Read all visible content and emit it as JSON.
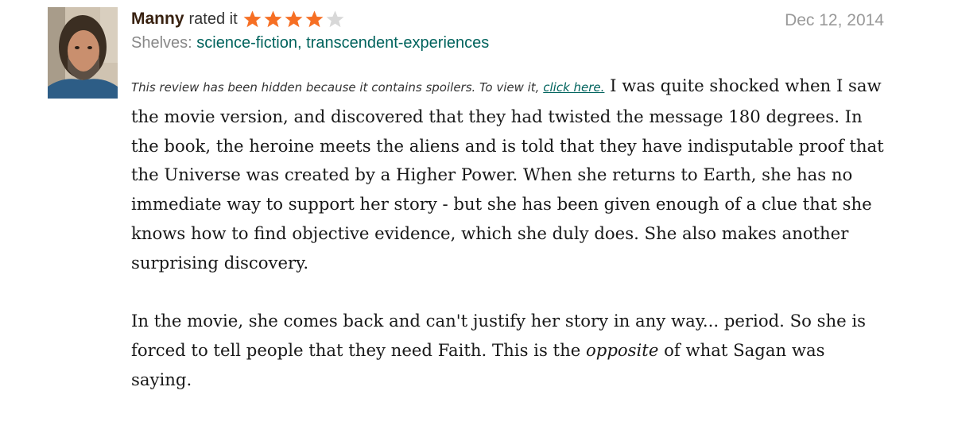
{
  "reviewer": {
    "name": "Manny",
    "rated_text": "rated it",
    "rating": 4,
    "max_rating": 5
  },
  "review": {
    "date": "Dec 12, 2014",
    "shelves_label": "Shelves:",
    "shelves": [
      "science-fiction",
      "transcendent-experiences"
    ],
    "shelf_separator": ",",
    "spoiler_note": "This review has been hidden because it contains spoilers. To view it,",
    "spoiler_link": "click here.",
    "paragraph1": "I was quite shocked when I saw the movie version, and discovered that they had twisted the message 180 degrees. In the book, the heroine meets the aliens and is told that they have indisputable proof that the Universe was created by a Higher Power. When she returns to Earth, she has no immediate way to support her story - but she has been given enough of a clue that she knows how to find objective evidence, which she duly does. She also makes another surprising discovery.",
    "paragraph2_start": "In the movie, she comes back and can't justify her story in any way... period. So she is forced to tell people that they need Faith. This is the",
    "paragraph2_emphasis": "opposite",
    "paragraph2_end": "of what Sagan was saying."
  },
  "colors": {
    "star_filled": "#f66f24",
    "star_empty": "#d8d8d8",
    "name": "#382110",
    "link": "#00635d",
    "date": "#999999"
  },
  "icons": {
    "avatar": "user-photo",
    "star": "star-icon"
  }
}
